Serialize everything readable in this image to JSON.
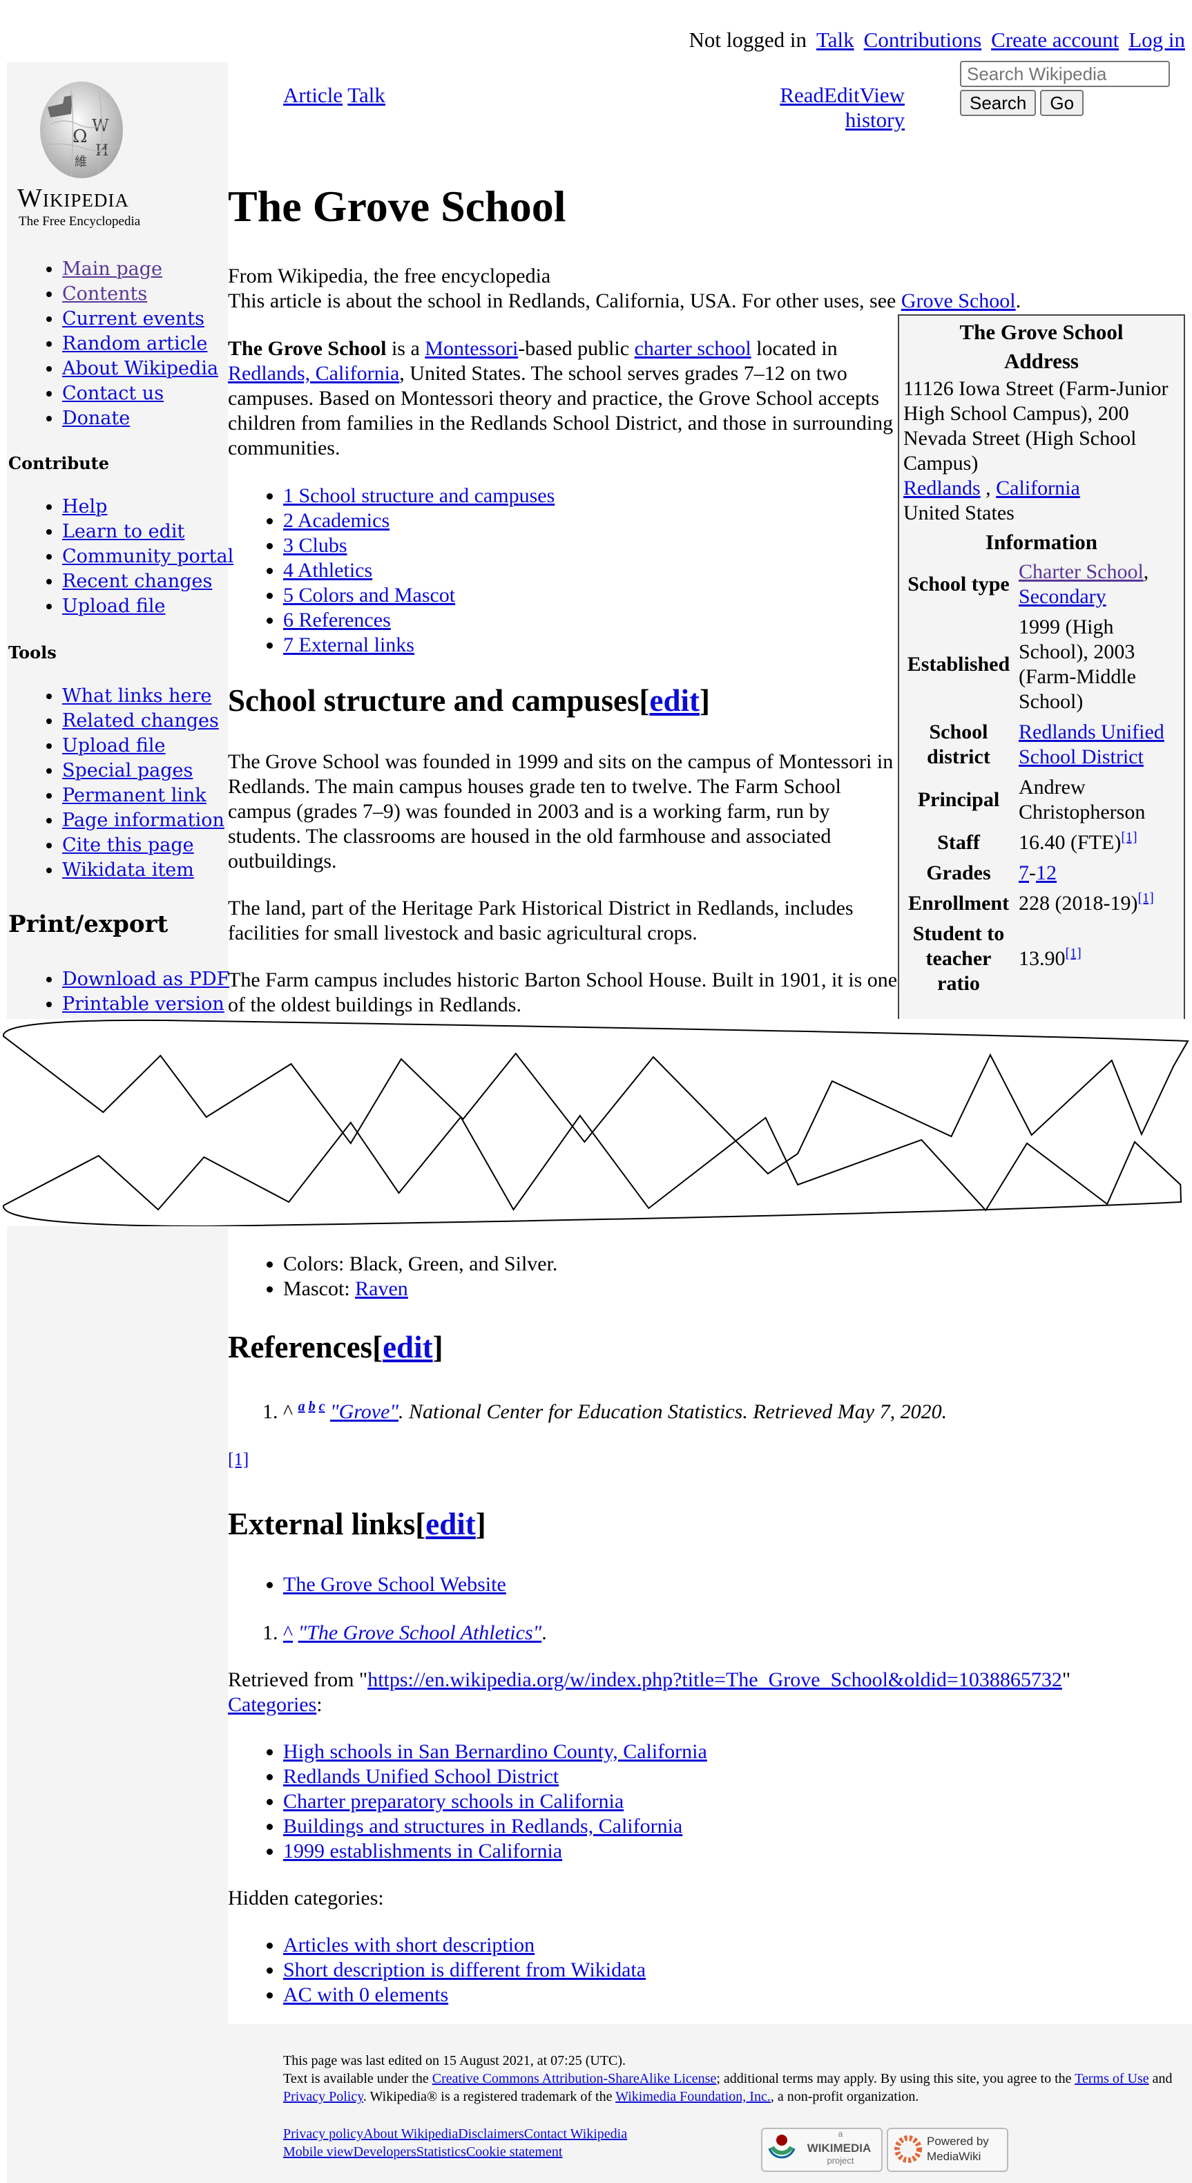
{
  "personal_tools": {
    "status": "Not logged in",
    "links": [
      "Talk",
      "Contributions",
      "Create account",
      "Log in"
    ]
  },
  "logo": {
    "wordmark": "Wikipedia",
    "tagline": "The Free Encyclopedia"
  },
  "sidebar": {
    "navigation": [
      "Main page",
      "Contents",
      "Current events",
      "Random article",
      "About Wikipedia",
      "Contact us",
      "Donate"
    ],
    "contribute_heading": "Contribute",
    "contribute": [
      "Help",
      "Learn to edit",
      "Community portal",
      "Recent changes",
      "Upload file"
    ],
    "tools_heading": "Tools",
    "tools": [
      "What links here",
      "Related changes",
      "Upload file",
      "Special pages",
      "Permanent link",
      "Page information",
      "Cite this page",
      "Wikidata item"
    ],
    "print_heading": "Print/export",
    "print": [
      "Download as PDF",
      "Printable version"
    ]
  },
  "tabs": {
    "article": "Article",
    "talk": "Talk",
    "read": "Read",
    "edit": "Edit",
    "view_history": "View history"
  },
  "search": {
    "placeholder": "Search Wikipedia",
    "search_button": "Search",
    "go_button": "Go"
  },
  "article": {
    "title": "The Grove School",
    "tagline": "From Wikipedia, the free encyclopedia",
    "hatnote_text": "This article is about the school in Redlands, California, USA. For other uses, see ",
    "hatnote_link": "Grove School",
    "intro": {
      "bold": "The Grove School",
      "t1": " is a ",
      "l1": "Montessori",
      "t2": "-based public ",
      "l2": "charter school",
      "t3": " located in ",
      "l3": "Redlands, California",
      "t4": ", United States. The school serves grades 7–12 on two campuses. Based on Montessori theory and practice, the Grove School accepts children from families in the Redlands School District, and those in surrounding communities."
    },
    "toc": [
      "1 School structure and campuses",
      "2 Academics",
      "3 Clubs",
      "4 Athletics",
      "5 Colors and Mascot",
      "6 References",
      "7 External links"
    ],
    "edit_label": "edit",
    "section1_heading": "School structure and campuses",
    "section1_paragraphs": [
      "The Grove School was founded in 1999 and sits on the campus of Montessori in Redlands. The main campus houses grade ten to twelve. The Farm School campus (grades 7–9) was founded in 2003 and is a working farm, run by students. The classrooms are housed in the old farmhouse and associated outbuildings.",
      "The land, part of the Heritage Park Historical District in Redlands, includes facilities for small livestock and basic agricultural crops.",
      "The Farm campus includes historic Barton School House. Built in 1901, it is one of the oldest buildings in Redlands."
    ],
    "colors_items": {
      "colors": "Colors: Black, Green, and Silver.",
      "mascot_label": "Mascot: ",
      "mascot_link": "Raven"
    },
    "references_heading": "References",
    "reference": {
      "caret": "^",
      "backlinks": [
        "a",
        "b",
        "c"
      ],
      "title": "\"Grove\"",
      "rest": ". National Center for Education Statistics. Retrieved May 7, 2020."
    },
    "stray_ref": "[1]",
    "external_heading": "External links",
    "external_links": [
      "The Grove School Website"
    ],
    "external_note": {
      "caret": "^",
      "title": "\"The Grove School Athletics\"",
      "rest": "."
    },
    "retrieved_prefix": "Retrieved from \"",
    "retrieved_url": "https://en.wikipedia.org/w/index.php?title=The_Grove_School&oldid=1038865732",
    "retrieved_suffix": "\"",
    "categories_label": "Categories",
    "categories": [
      "High schools in San Bernardino County, California",
      "Redlands Unified School District",
      "Charter preparatory schools in California",
      "Buildings and structures in Redlands, California",
      "1999 establishments in California"
    ],
    "hidden_categories_label": "Hidden categories:",
    "hidden_categories": [
      "Articles with short description",
      "Short description is different from Wikidata",
      "AC with 0 elements"
    ]
  },
  "infobox": {
    "caption": "The Grove School",
    "address_heading": "Address",
    "address": "11126 Iowa Street (Farm-Junior High School Campus), 200 Nevada Street (High School Campus)",
    "city": "Redlands",
    "state": "California",
    "country": "United States",
    "info_heading": "Information",
    "rows": {
      "school_type_label": "School type",
      "school_type_1": "Charter School",
      "school_type_2": "Secondary",
      "established_label": "Established",
      "established": "1999 (High School), 2003 (Farm-Middle School)",
      "district_label": "School district",
      "district": "Redlands Unified School District",
      "principal_label": "Principal",
      "principal": "Andrew Christopherson",
      "staff_label": "Staff",
      "staff": "16.40 (FTE)",
      "grades_label": "Grades",
      "grade_from": "7",
      "grade_to": "12",
      "enrollment_label": "Enrollment",
      "enrollment": "228 (2018-19)",
      "ratio_label": "Student to teacher ratio",
      "ratio": "13.90",
      "ref": "[1]"
    }
  },
  "footer": {
    "last_edited": "This page was last edited on 15 August 2021, at 07:25 (UTC).",
    "license_t1": "Text is available under the ",
    "license_link": "Creative Commons Attribution-ShareAlike License",
    "license_t2": "; additional terms may apply. By using this site, you agree to the ",
    "terms_link": "Terms of Use",
    "license_t3": " and ",
    "privacy_link": "Privacy Policy",
    "license_t4": ". Wikipedia® is a registered trademark of the ",
    "foundation_link": "Wikimedia Foundation, Inc.",
    "license_t5": ", a non-profit organization.",
    "links_row1": [
      "Privacy policy",
      "About Wikipedia",
      "Disclaimers",
      "Contact Wikipedia"
    ],
    "links_row2": [
      "Mobile view",
      "Developers",
      "Statistics",
      "Cookie statement"
    ],
    "wikimedia_badge": {
      "top": "a",
      "middle": "WIKIMEDIA",
      "bottom": "project"
    },
    "mediawiki_badge": {
      "top": "Powered by",
      "bottom": "MediaWiki"
    }
  }
}
